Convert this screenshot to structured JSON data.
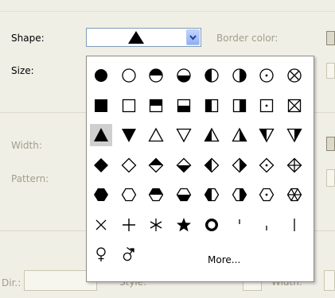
{
  "form": {
    "shape_label": "Shape:",
    "size_label": "Size:",
    "border_color_label": "Border color:",
    "width_label": "Width:",
    "pattern_label": "Pattern:",
    "dir_label": "Dir.:",
    "style_label": "Style:",
    "width2_label": "Width:"
  },
  "shape_combo": {
    "selected_icon": "filled-triangle-up"
  },
  "popup": {
    "more_label": "More...",
    "selected_shape": "filled-triangle-up",
    "rows": [
      [
        "filled-circle",
        "empty-circle",
        "circle-top-half",
        "circle-bottom-half",
        "circle-left-half",
        "circle-right-half",
        "circle-dot",
        "circle-x"
      ],
      [
        "filled-square",
        "empty-square",
        "square-top-half",
        "square-bottom-half",
        "square-left-half",
        "square-right-half",
        "square-dot",
        "square-x"
      ],
      [
        "filled-triangle-up",
        "filled-triangle-down",
        "empty-triangle-up",
        "empty-triangle-down",
        "triangle-up-left-half",
        "triangle-up-right-half",
        "triangle-down-left-half",
        "triangle-down-right-half"
      ],
      [
        "filled-diamond",
        "empty-diamond",
        "diamond-top-half",
        "diamond-bottom-half",
        "diamond-left-half",
        "diamond-right-half",
        "diamond-dot",
        "diamond-plus"
      ],
      [
        "filled-hexagon",
        "empty-hexagon",
        "hexagon-top-half",
        "hexagon-bottom-half",
        "hexagon-left-half",
        "hexagon-right-half",
        "hexagon-dot",
        "hexagon-asterisk"
      ],
      [
        "cross-x",
        "plus",
        "asterisk",
        "star",
        "thick-ring",
        "short-tick-top",
        "short-tick-bottom",
        "vertical-line"
      ],
      [
        "female-symbol",
        "male-symbol"
      ]
    ]
  },
  "colors": {
    "combo_border": "#7f9db9",
    "dropdown_button": "#8fb0f4",
    "selected_cell": "#cfcfcf"
  }
}
